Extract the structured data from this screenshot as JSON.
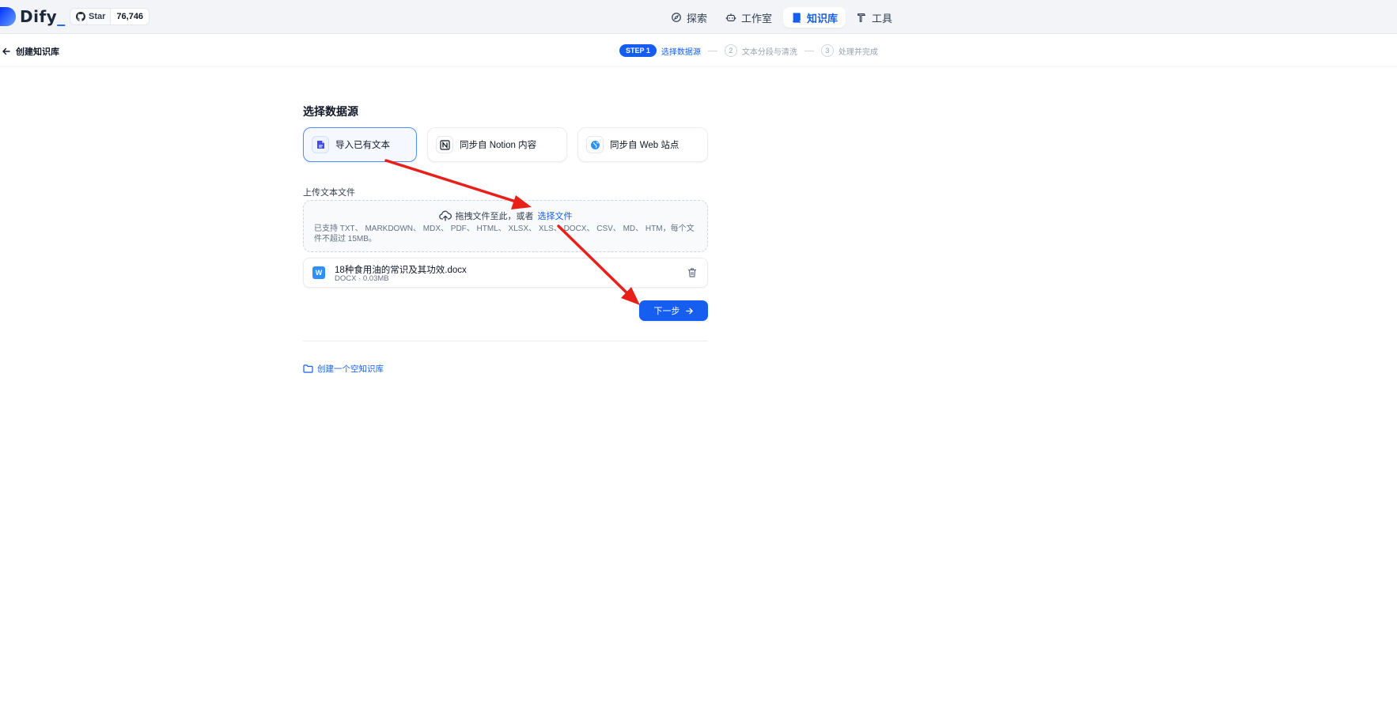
{
  "app": {
    "brand": "Dify",
    "brand_cursor": "_",
    "github_star_label": "Star",
    "github_star_count": "76,746"
  },
  "nav": {
    "explore": "探索",
    "studio": "工作室",
    "knowledge": "知识库",
    "tools": "工具"
  },
  "subheader": {
    "back_title": "创建知识库",
    "steps": {
      "step1_badge": "STEP 1",
      "step1_label": "选择数据源",
      "step2_num": "2",
      "step2_label": "文本分段与清洗",
      "step3_num": "3",
      "step3_label": "处理并完成"
    }
  },
  "main": {
    "section_title": "选择数据源",
    "sources": [
      {
        "label": "导入已有文本",
        "active": true
      },
      {
        "label": "同步自 Notion 内容",
        "active": false
      },
      {
        "label": "同步自 Web 站点",
        "active": false
      }
    ],
    "upload_label": "上传文本文件",
    "dropzone": {
      "prompt": "拖拽文件至此，或者",
      "link": "选择文件",
      "hint": "已支持 TXT、 MARKDOWN、 MDX、 PDF、 HTML、 XLSX、 XLS、 DOCX、 CSV、 MD、 HTM，每个文件不超过 15MB。"
    },
    "file": {
      "badge": "W",
      "name": "18种食用油的常识及其功效.docx",
      "meta": "DOCX · 0.03MB"
    },
    "next_button": "下一步",
    "create_empty": "创建一个空知识库"
  },
  "colors": {
    "primary": "#155eef",
    "annotation_arrow": "#e8201a"
  }
}
